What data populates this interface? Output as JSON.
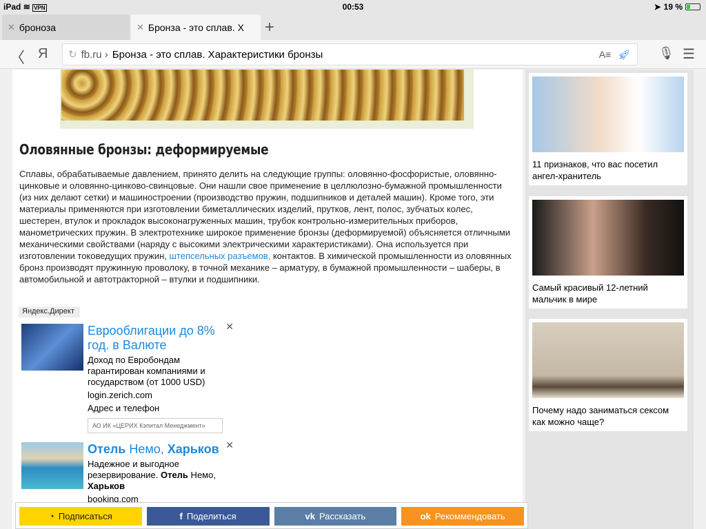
{
  "status": {
    "device": "iPad",
    "vpn": "VPN",
    "time": "00:53",
    "battery": "19 %"
  },
  "tabs": [
    {
      "label": "броноза"
    },
    {
      "label": "Бронза - это сплав. Х"
    }
  ],
  "address": {
    "domain": "fb.ru ›",
    "title": "Бронза - это сплав. Характеристики бронзы",
    "yandex": "Я"
  },
  "article": {
    "heading": "Оловянные бронзы: деформируемые",
    "para_before_link": "Сплавы, обрабатываемые давлением, принято делить на следующие группы: оловянно-фосфористые, оловянно-цинковые и оловянно-цинково-свинцовые. Они нашли свое применение в целлюлозно-бумажной промышленности (из них делают сетки) и машиностроении (производство пружин, подшипников и деталей машин). Кроме того, эти материалы применяются при изготовлении биметаллических изделий, прутков, лент, полос, зубчатых колес, шестерен, втулок и прокладок высоконагруженных машин, трубок контрольно-измерительных приборов, манометрических пружин. В электротехнике широкое применение бронзы (деформируемой) объясняется отличными механическими свойствами (наряду с высокими электрическими характеристиками). Она используется при изготовлении токоведущих пружин, ",
    "link": "штепсельных разъемов,",
    "para_after_link": " контактов. В химической промышленности из оловянных бронз производят пружинную проволоку, в точной механике – арматуру, в бумажной промышленности – шаберы, в автомобильной и автотракторной – втулки и подшипники."
  },
  "ads": {
    "label": "Яндекс.Директ",
    "items": [
      {
        "title": "Еврооблигации до 8% год. в Валюте",
        "desc": "Доход по Евробондам гарантирован компаниями и государством (от 1000 USD)",
        "url": "login.zerich.com",
        "contact": "Адрес и телефон",
        "company": "АО ИК «ЦЕРИХ Кэпитал Менеджмент»"
      },
      {
        "title_b1": "Отель",
        "title_n": " Немо, ",
        "title_b2": "Харьков",
        "desc1": "Надежное и выгодное резервирование. ",
        "desc_b1": "Отель",
        "desc2": " Немо, ",
        "desc_b2": "Харьков",
        "url": "booking.com"
      }
    ]
  },
  "share": [
    {
      "label": "Подписаться",
      "color": "#ffd400"
    },
    {
      "label": "Поделиться",
      "color": "#3b5998"
    },
    {
      "label": "Рассказать",
      "color": "#5b7fa6"
    },
    {
      "label": "Рекоммендовать",
      "color": "#f7931e"
    }
  ],
  "sidebar": [
    {
      "caption": "11 признаков, что вас посетил ангел-хранитель"
    },
    {
      "caption": "Самый красивый 12-летний мальчик в мире"
    },
    {
      "caption": "Почему надо заниматься сексом как можно чаще?"
    }
  ]
}
